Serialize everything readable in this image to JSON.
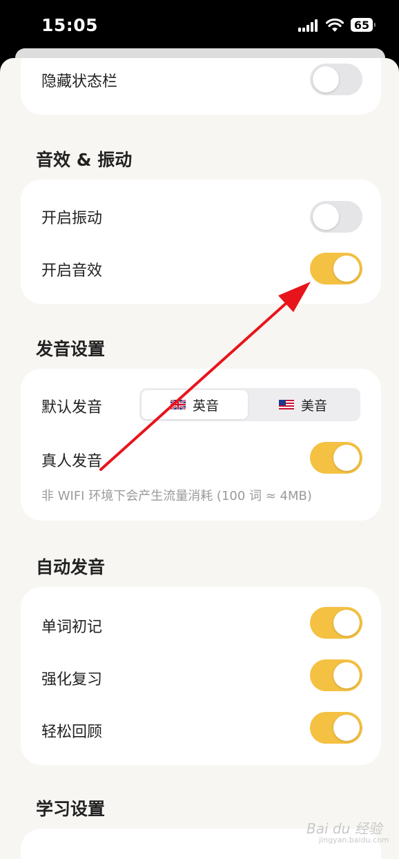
{
  "status_bar": {
    "time": "15:05",
    "battery": "65"
  },
  "display": {
    "hide_status_bar": {
      "label": "隐藏状态栏",
      "on": false
    }
  },
  "sound_vibration": {
    "title": "音效 & 振动",
    "vibration": {
      "label": "开启振动",
      "on": false
    },
    "sound_effect": {
      "label": "开启音效",
      "on": true
    }
  },
  "pronunciation": {
    "title": "发音设置",
    "default_label": "默认发音",
    "options": [
      {
        "label": "英音",
        "flag": "uk-flag-icon",
        "selected": true
      },
      {
        "label": "美音",
        "flag": "us-flag-icon",
        "selected": false
      }
    ],
    "real_voice": {
      "label": "真人发音",
      "on": true
    },
    "note": "非 WIFI 环境下会产生流量消耗 (100 词 ≈ 4MB)"
  },
  "auto_pronounce": {
    "title": "自动发音",
    "items": [
      {
        "label": "单词初记",
        "on": true
      },
      {
        "label": "强化复习",
        "on": true
      },
      {
        "label": "轻松回顾",
        "on": true
      }
    ]
  },
  "study": {
    "title": "学习设置"
  },
  "watermark": {
    "text": "Bai du 经验",
    "sub": "jingyan.baidu.com"
  },
  "colors": {
    "accent": "#f4c142",
    "toggle_off": "#e5e5e8",
    "arrow": "#e8141b"
  }
}
